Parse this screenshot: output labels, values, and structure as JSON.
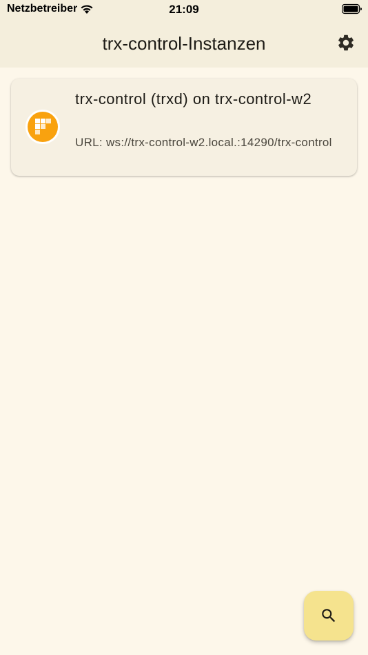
{
  "status_bar": {
    "carrier": "Netzbetreiber",
    "time": "21:09",
    "wifi_icon": "wifi-icon",
    "battery_icon": "battery-icon"
  },
  "app_bar": {
    "title": "trx-control-Instanzen",
    "settings_icon": "gear-icon"
  },
  "instances": [
    {
      "title": "trx-control (trxd) on trx-control-w2",
      "subtitle": "URL: ws://trx-control-w2.local.:14290/trx-control",
      "avatar_icon": "app-logo-icon",
      "avatar_color": "#f9a20f"
    }
  ],
  "fab": {
    "icon": "search-icon",
    "color": "#f5e38e"
  },
  "colors": {
    "background": "#fdf7ea",
    "app_bar": "#f4eedc",
    "card": "#f6f0e2"
  }
}
